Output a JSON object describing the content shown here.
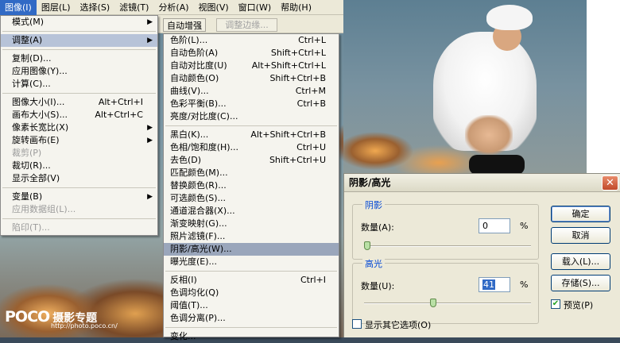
{
  "menubar": {
    "items": [
      {
        "label": "图像(I)",
        "active": true
      },
      {
        "label": "图层(L)"
      },
      {
        "label": "选择(S)"
      },
      {
        "label": "滤镜(T)"
      },
      {
        "label": "分析(A)"
      },
      {
        "label": "视图(V)"
      },
      {
        "label": "窗口(W)"
      },
      {
        "label": "帮助(H)"
      }
    ]
  },
  "toolbar": {
    "auto_enhance": "自动增强",
    "refine_edge": "调整边缘..."
  },
  "image_menu": {
    "items": [
      {
        "label": "模式(M)",
        "submenu": true
      },
      {
        "sep": true
      },
      {
        "label": "调整(A)",
        "submenu": true,
        "highlighted": true
      },
      {
        "sep": true
      },
      {
        "label": "复制(D)..."
      },
      {
        "label": "应用图像(Y)..."
      },
      {
        "label": "计算(C)..."
      },
      {
        "sep": true
      },
      {
        "label": "图像大小(I)...",
        "shortcut": "Alt+Ctrl+I"
      },
      {
        "label": "画布大小(S)...",
        "shortcut": "Alt+Ctrl+C"
      },
      {
        "label": "像素长宽比(X)",
        "submenu": true
      },
      {
        "label": "旋转画布(E)",
        "submenu": true
      },
      {
        "label": "裁剪(P)",
        "disabled": true
      },
      {
        "label": "裁切(R)..."
      },
      {
        "label": "显示全部(V)"
      },
      {
        "sep": true
      },
      {
        "label": "变量(B)",
        "submenu": true
      },
      {
        "label": "应用数据组(L)...",
        "disabled": true
      },
      {
        "sep": true
      },
      {
        "label": "陷印(T)...",
        "disabled": true
      }
    ]
  },
  "adjust_menu": {
    "items": [
      {
        "label": "色阶(L)...",
        "shortcut": "Ctrl+L"
      },
      {
        "label": "自动色阶(A)",
        "shortcut": "Shift+Ctrl+L"
      },
      {
        "label": "自动对比度(U)",
        "shortcut": "Alt+Shift+Ctrl+L"
      },
      {
        "label": "自动颜色(O)",
        "shortcut": "Shift+Ctrl+B"
      },
      {
        "label": "曲线(V)...",
        "shortcut": "Ctrl+M"
      },
      {
        "label": "色彩平衡(B)...",
        "shortcut": "Ctrl+B"
      },
      {
        "label": "亮度/对比度(C)..."
      },
      {
        "sep": true
      },
      {
        "label": "黑白(K)...",
        "shortcut": "Alt+Shift+Ctrl+B"
      },
      {
        "label": "色相/饱和度(H)...",
        "shortcut": "Ctrl+U"
      },
      {
        "label": "去色(D)",
        "shortcut": "Shift+Ctrl+U"
      },
      {
        "label": "匹配颜色(M)..."
      },
      {
        "label": "替换颜色(R)..."
      },
      {
        "label": "可选颜色(S)..."
      },
      {
        "label": "通道混合器(X)..."
      },
      {
        "label": "渐变映射(G)..."
      },
      {
        "label": "照片滤镜(F)..."
      },
      {
        "label": "阴影/高光(W)...",
        "highlighted": true
      },
      {
        "label": "曝光度(E)..."
      },
      {
        "sep": true
      },
      {
        "label": "反相(I)",
        "shortcut": "Ctrl+I"
      },
      {
        "label": "色调均化(Q)"
      },
      {
        "label": "阈值(T)..."
      },
      {
        "label": "色调分离(P)..."
      },
      {
        "sep": true
      },
      {
        "label": "变化..."
      }
    ]
  },
  "dialog": {
    "title": "阴影/高光",
    "shadows": {
      "legend": "阴影",
      "amount_label": "数量(A):",
      "amount": "0",
      "unit": "%",
      "slider_fraction": 0.0
    },
    "highlights": {
      "legend": "高光",
      "amount_label": "数量(U):",
      "amount": "41",
      "unit": "%",
      "slider_fraction": 0.41
    },
    "buttons": {
      "ok": "确定",
      "cancel": "取消",
      "load": "载入(L)...",
      "save": "存储(S)..."
    },
    "preview_label": "预览(P)",
    "preview_checked": true,
    "more_options_label": "显示其它选项(O)",
    "more_options_checked": false
  },
  "watermark": {
    "logo": "POCO",
    "title": "摄影专题",
    "url": "http://photo.poco.cn/"
  }
}
